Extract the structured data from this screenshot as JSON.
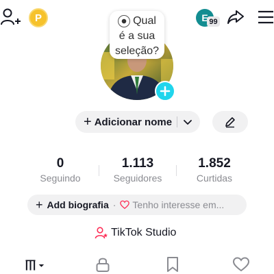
{
  "top_bar": {
    "coin_letter": "P",
    "friend_avatar_letter": "E",
    "friend_badge": "99",
    "icons": [
      "add-user-icon",
      "coin-icon",
      "share-icon",
      "menu-icon"
    ]
  },
  "question_bubble": {
    "icon": "soccer-ball-icon",
    "line1": "Qual",
    "line2": "é a sua",
    "line3": "seleção?"
  },
  "profile": {
    "add_name_label": "Adicionar nome",
    "add_photo_icon": "plus-icon",
    "edit_icon": "pencil-icon"
  },
  "stats": [
    {
      "value": "0",
      "label": "Seguindo"
    },
    {
      "value": "1.113",
      "label": "Seguidores"
    },
    {
      "value": "1.852",
      "label": "Curtidas"
    }
  ],
  "bio": {
    "add_label": "Add biografia",
    "separator": "·",
    "interest_text": "Tenho interesse em..."
  },
  "studio": {
    "label": "TikTok Studio"
  },
  "tabs": [
    "videos-grid-icon",
    "lock-icon",
    "bookmark-icon",
    "heart-icon"
  ],
  "colors": {
    "accent_cyan": "#20d5ec",
    "coin_gold": "#f6c22c",
    "friend_teal": "#138d91",
    "heart_pink": "#fe2c55",
    "text_primary": "#161823",
    "text_secondary": "#8a8b91",
    "pill_gray": "#f1f1f2"
  }
}
